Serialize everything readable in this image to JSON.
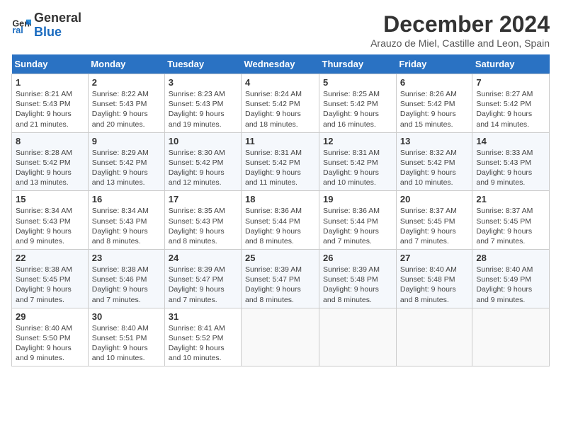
{
  "logo": {
    "line1": "General",
    "line2": "Blue"
  },
  "title": "December 2024",
  "subtitle": "Arauzo de Miel, Castille and Leon, Spain",
  "days_of_week": [
    "Sunday",
    "Monday",
    "Tuesday",
    "Wednesday",
    "Thursday",
    "Friday",
    "Saturday"
  ],
  "weeks": [
    [
      {
        "day": 1,
        "sunrise": "8:21 AM",
        "sunset": "5:43 PM",
        "daylight": "9 hours and 21 minutes."
      },
      {
        "day": 2,
        "sunrise": "8:22 AM",
        "sunset": "5:43 PM",
        "daylight": "9 hours and 20 minutes."
      },
      {
        "day": 3,
        "sunrise": "8:23 AM",
        "sunset": "5:43 PM",
        "daylight": "9 hours and 19 minutes."
      },
      {
        "day": 4,
        "sunrise": "8:24 AM",
        "sunset": "5:42 PM",
        "daylight": "9 hours and 18 minutes."
      },
      {
        "day": 5,
        "sunrise": "8:25 AM",
        "sunset": "5:42 PM",
        "daylight": "9 hours and 16 minutes."
      },
      {
        "day": 6,
        "sunrise": "8:26 AM",
        "sunset": "5:42 PM",
        "daylight": "9 hours and 15 minutes."
      },
      {
        "day": 7,
        "sunrise": "8:27 AM",
        "sunset": "5:42 PM",
        "daylight": "9 hours and 14 minutes."
      }
    ],
    [
      {
        "day": 8,
        "sunrise": "8:28 AM",
        "sunset": "5:42 PM",
        "daylight": "9 hours and 13 minutes."
      },
      {
        "day": 9,
        "sunrise": "8:29 AM",
        "sunset": "5:42 PM",
        "daylight": "9 hours and 13 minutes."
      },
      {
        "day": 10,
        "sunrise": "8:30 AM",
        "sunset": "5:42 PM",
        "daylight": "9 hours and 12 minutes."
      },
      {
        "day": 11,
        "sunrise": "8:31 AM",
        "sunset": "5:42 PM",
        "daylight": "9 hours and 11 minutes."
      },
      {
        "day": 12,
        "sunrise": "8:31 AM",
        "sunset": "5:42 PM",
        "daylight": "9 hours and 10 minutes."
      },
      {
        "day": 13,
        "sunrise": "8:32 AM",
        "sunset": "5:42 PM",
        "daylight": "9 hours and 10 minutes."
      },
      {
        "day": 14,
        "sunrise": "8:33 AM",
        "sunset": "5:43 PM",
        "daylight": "9 hours and 9 minutes."
      }
    ],
    [
      {
        "day": 15,
        "sunrise": "8:34 AM",
        "sunset": "5:43 PM",
        "daylight": "9 hours and 9 minutes."
      },
      {
        "day": 16,
        "sunrise": "8:34 AM",
        "sunset": "5:43 PM",
        "daylight": "9 hours and 8 minutes."
      },
      {
        "day": 17,
        "sunrise": "8:35 AM",
        "sunset": "5:43 PM",
        "daylight": "9 hours and 8 minutes."
      },
      {
        "day": 18,
        "sunrise": "8:36 AM",
        "sunset": "5:44 PM",
        "daylight": "9 hours and 8 minutes."
      },
      {
        "day": 19,
        "sunrise": "8:36 AM",
        "sunset": "5:44 PM",
        "daylight": "9 hours and 7 minutes."
      },
      {
        "day": 20,
        "sunrise": "8:37 AM",
        "sunset": "5:45 PM",
        "daylight": "9 hours and 7 minutes."
      },
      {
        "day": 21,
        "sunrise": "8:37 AM",
        "sunset": "5:45 PM",
        "daylight": "9 hours and 7 minutes."
      }
    ],
    [
      {
        "day": 22,
        "sunrise": "8:38 AM",
        "sunset": "5:45 PM",
        "daylight": "9 hours and 7 minutes."
      },
      {
        "day": 23,
        "sunrise": "8:38 AM",
        "sunset": "5:46 PM",
        "daylight": "9 hours and 7 minutes."
      },
      {
        "day": 24,
        "sunrise": "8:39 AM",
        "sunset": "5:47 PM",
        "daylight": "9 hours and 7 minutes."
      },
      {
        "day": 25,
        "sunrise": "8:39 AM",
        "sunset": "5:47 PM",
        "daylight": "9 hours and 8 minutes."
      },
      {
        "day": 26,
        "sunrise": "8:39 AM",
        "sunset": "5:48 PM",
        "daylight": "9 hours and 8 minutes."
      },
      {
        "day": 27,
        "sunrise": "8:40 AM",
        "sunset": "5:48 PM",
        "daylight": "9 hours and 8 minutes."
      },
      {
        "day": 28,
        "sunrise": "8:40 AM",
        "sunset": "5:49 PM",
        "daylight": "9 hours and 9 minutes."
      }
    ],
    [
      {
        "day": 29,
        "sunrise": "8:40 AM",
        "sunset": "5:50 PM",
        "daylight": "9 hours and 9 minutes."
      },
      {
        "day": 30,
        "sunrise": "8:40 AM",
        "sunset": "5:51 PM",
        "daylight": "9 hours and 10 minutes."
      },
      {
        "day": 31,
        "sunrise": "8:41 AM",
        "sunset": "5:52 PM",
        "daylight": "9 hours and 10 minutes."
      },
      null,
      null,
      null,
      null
    ]
  ]
}
